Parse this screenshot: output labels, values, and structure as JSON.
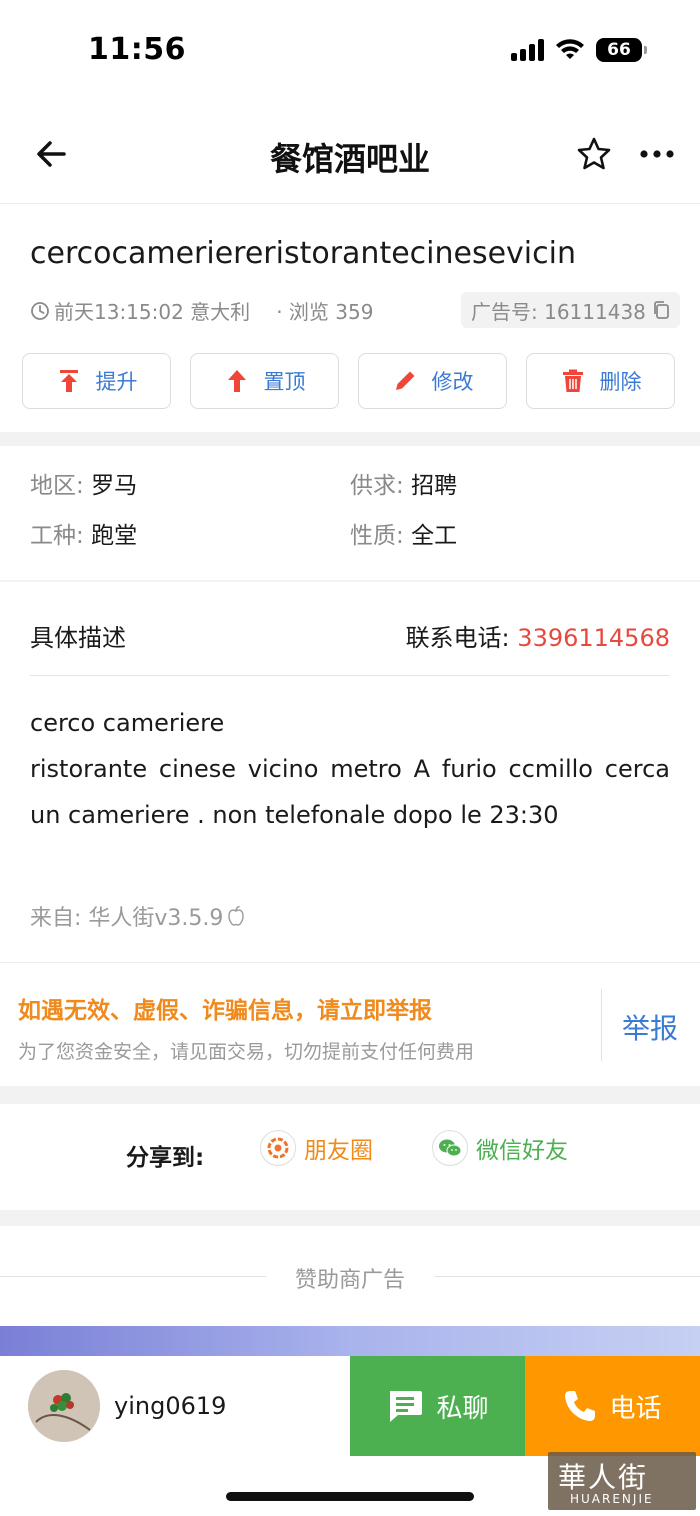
{
  "status_bar": {
    "time": "11:56",
    "battery": "66"
  },
  "nav": {
    "title": "餐馆酒吧业"
  },
  "post": {
    "title": "cercocameriereristorantecinesevicin",
    "time_location": "前天13:15:02 意大利",
    "views": "· 浏览 359",
    "ad_number": "广告号: 16111438"
  },
  "actions": [
    {
      "label": "提升",
      "icon": "boost-icon"
    },
    {
      "label": "置顶",
      "icon": "arrow-up-icon"
    },
    {
      "label": "修改",
      "icon": "pencil-icon"
    },
    {
      "label": "删除",
      "icon": "trash-icon"
    }
  ],
  "info": {
    "region": {
      "key": "地区:",
      "value": "罗马"
    },
    "supply": {
      "key": "供求:",
      "value": "招聘"
    },
    "job_type": {
      "key": "工种:",
      "value": "跑堂"
    },
    "nature": {
      "key": "性质:",
      "value": "全工"
    }
  },
  "description": {
    "label": "具体描述",
    "phone_label": "联系电话:",
    "phone": "3396114568",
    "line1": "cerco cameriere",
    "line2": "ristorante cinese vicino metro A furio ccmillo cerca un cameriere . non telefonale dopo le 23:30",
    "source": "来自: 华人街v3.5.9"
  },
  "warning": {
    "title": "如遇无效、虚假、诈骗信息，请立即举报",
    "subtitle": "为了您资金安全，请见面交易，切勿提前支付任何费用",
    "report": "举报"
  },
  "share": {
    "label": "分享到:",
    "moments": "朋友圈",
    "wechat": "微信好友"
  },
  "sponsor": {
    "label": "赞助商广告"
  },
  "bottom": {
    "username": "ying0619",
    "chat": "私聊",
    "call": "电话"
  },
  "watermark": {
    "cn": "華人街",
    "en": "HUARENJIE"
  },
  "colors": {
    "accent_blue": "#3a7bd5",
    "phone_red": "#e8493f",
    "warn_orange": "#f08a1c",
    "chat_green": "#4caf50",
    "call_orange": "#ff9800",
    "action_red": "#f0463a"
  }
}
